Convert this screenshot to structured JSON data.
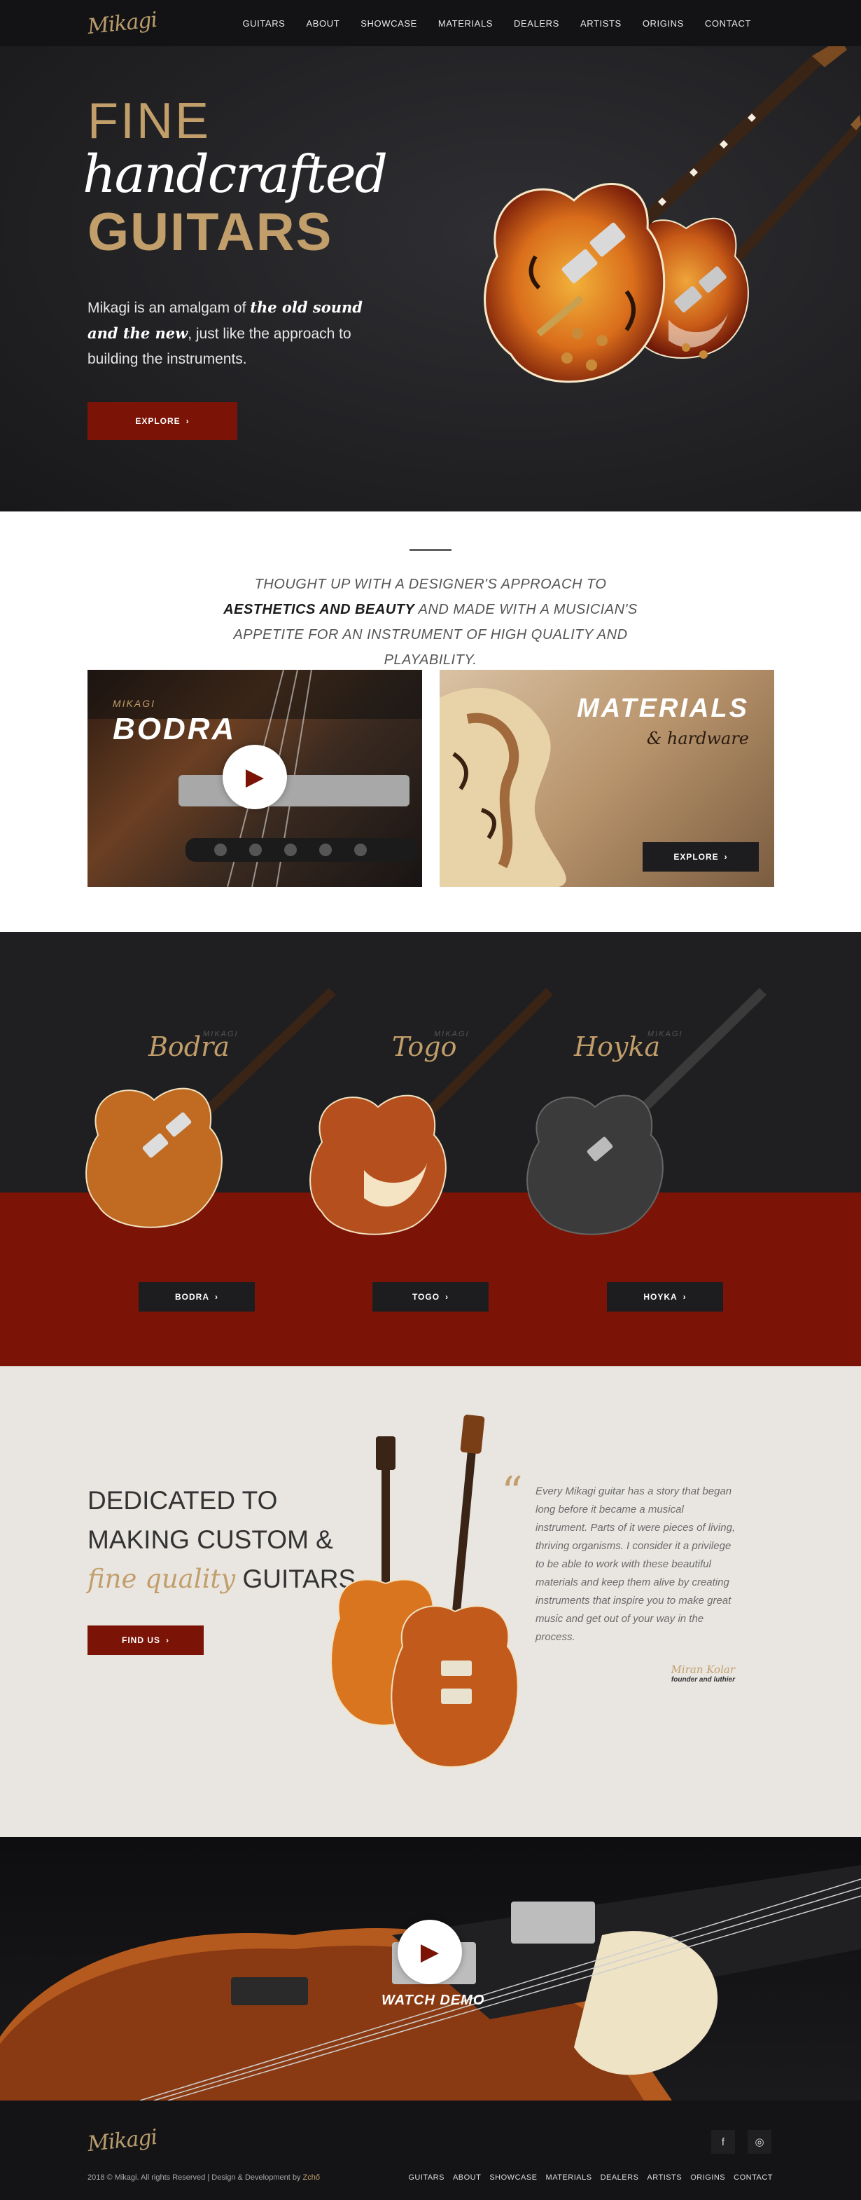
{
  "nav": {
    "logo": "Mikagi",
    "links": [
      "GUITARS",
      "ABOUT",
      "SHOWCASE",
      "MATERIALS",
      "DEALERS",
      "ARTISTS",
      "ORIGINS",
      "CONTACT"
    ]
  },
  "hero": {
    "line1": "FINE",
    "line2": "handcrafted",
    "line3": "GUITARS",
    "intro_before": "Mikagi is an amalgam of ",
    "intro_em": "the old sound and the new",
    "intro_after": ", just like the approach to building the instruments.",
    "explore": "EXPLORE",
    "prev": "‹",
    "next": "›"
  },
  "intro": {
    "tag_before": "THOUGHT UP WITH A DESIGNER'S APPROACH TO ",
    "tag_bold": "AESTHETICS AND BEAUTY",
    "tag_after": " AND MADE WITH A MUSICIAN'S APPETITE FOR AN INSTRUMENT OF HIGH QUALITY AND PLAYABILITY.",
    "card1_brand": "MIKAGI",
    "card1_title": "BODRA",
    "card2_title": "MATERIALS",
    "card2_sub": "& hardware",
    "card2_button": "EXPLORE"
  },
  "models": [
    {
      "brand": "MIKAGI",
      "name": "Bodra",
      "button": "BODRA"
    },
    {
      "brand": "MIKAGI",
      "name": "Togo",
      "button": "TOGO"
    },
    {
      "brand": "MIKAGI",
      "name": "Hoyka",
      "button": "HOYKA"
    }
  ],
  "dedicated": {
    "line1": "DEDICATED TO",
    "line2": "MAKING CUSTOM &",
    "line3_em": "fine quality",
    "line3_rest": " GUITARS",
    "button": "FIND US",
    "quote": "Every Mikagi guitar has a story that began long before it became a musical instrument. Parts of it were pieces of living, thriving organisms. I consider it a privilege to be able to work with these beautiful materials and keep them alive by creating instruments that inspire you to make great music and get out of your way in the process.",
    "author": "Miran Kolar",
    "role": "founder and luthier"
  },
  "video": {
    "label": "WATCH DEMO"
  },
  "footer": {
    "logo": "Mikagi",
    "copy": "2018 © Mikagi. All rights Reserved | Design & Development by ",
    "dev": "Zchő",
    "links": [
      "GUITARS",
      "ABOUT",
      "SHOWCASE",
      "MATERIALS",
      "DEALERS",
      "ARTISTS",
      "ORIGINS",
      "CONTACT"
    ],
    "facebook": "f",
    "instagram": "◎"
  }
}
